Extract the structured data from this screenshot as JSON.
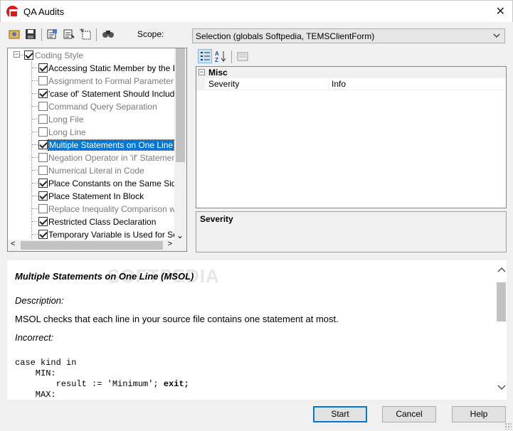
{
  "window": {
    "title": "QA Audits",
    "close_glyph": "✕"
  },
  "toolbar": {
    "scope_label": "Scope:",
    "scope_value": "Selection (globals Softpedia, TEMSClientForm)",
    "icons": [
      "open-audit-icon",
      "save-icon",
      "select-all-icon",
      "invert-selection-icon",
      "clear-selection-icon",
      "find-icon"
    ]
  },
  "tree": {
    "root": {
      "label": "Coding Style",
      "checked": true,
      "expander": "−"
    },
    "items": [
      {
        "label": "Accessing Static Member by the Desc",
        "checked": true,
        "enabled": true,
        "selected": false
      },
      {
        "label": "Assignment to Formal Parameter",
        "checked": false,
        "enabled": false,
        "selected": false
      },
      {
        "label": "'case of' Statement Should Include the",
        "checked": true,
        "enabled": true,
        "selected": false
      },
      {
        "label": "Command Query Separation",
        "checked": false,
        "enabled": false,
        "selected": false
      },
      {
        "label": "Long File",
        "checked": false,
        "enabled": false,
        "selected": false
      },
      {
        "label": "Long Line",
        "checked": false,
        "enabled": false,
        "selected": false
      },
      {
        "label": "Multiple Statements on One Line",
        "checked": true,
        "enabled": true,
        "selected": true
      },
      {
        "label": "Negation Operator in 'if' Statement",
        "checked": false,
        "enabled": false,
        "selected": false
      },
      {
        "label": "Numerical Literal in Code",
        "checked": false,
        "enabled": false,
        "selected": false
      },
      {
        "label": "Place Constants on the Same Side of",
        "checked": true,
        "enabled": true,
        "selected": false
      },
      {
        "label": "Place Statement In Block",
        "checked": true,
        "enabled": true,
        "selected": false
      },
      {
        "label": "Replace Inequality Comparison with E",
        "checked": false,
        "enabled": false,
        "selected": false
      },
      {
        "label": "Restricted Class Declaration",
        "checked": true,
        "enabled": true,
        "selected": false
      },
      {
        "label": "Temporary Variable is Used for Severa",
        "checked": true,
        "enabled": true,
        "selected": false
      }
    ],
    "hscroll_left": "<",
    "hscroll_right": ">",
    "vscroll_down": "⌄"
  },
  "properties": {
    "category": "Misc",
    "category_expander": "−",
    "rows": [
      {
        "name": "Severity",
        "value": "Info"
      }
    ],
    "help_title": "Severity",
    "icons": [
      "categorized-icon",
      "alphabetical-icon",
      "property-pages-icon"
    ]
  },
  "description": {
    "heading": "Multiple Statements on One Line (MSOL)",
    "description_label": "Description:",
    "text": "MSOL checks that each line in your source file contains one statement at most.",
    "incorrect_label": "Incorrect:",
    "code_lines": [
      "case kind in",
      "    MIN:",
      "        result := 'Minimum'; ",
      "    MAX:"
    ],
    "code_keyword": "exit;",
    "watermark": "SOFTPEDIA",
    "scroll_up": "⌃",
    "scroll_down": "⌄"
  },
  "buttons": {
    "start": "Start",
    "cancel": "Cancel",
    "help": "Help"
  }
}
